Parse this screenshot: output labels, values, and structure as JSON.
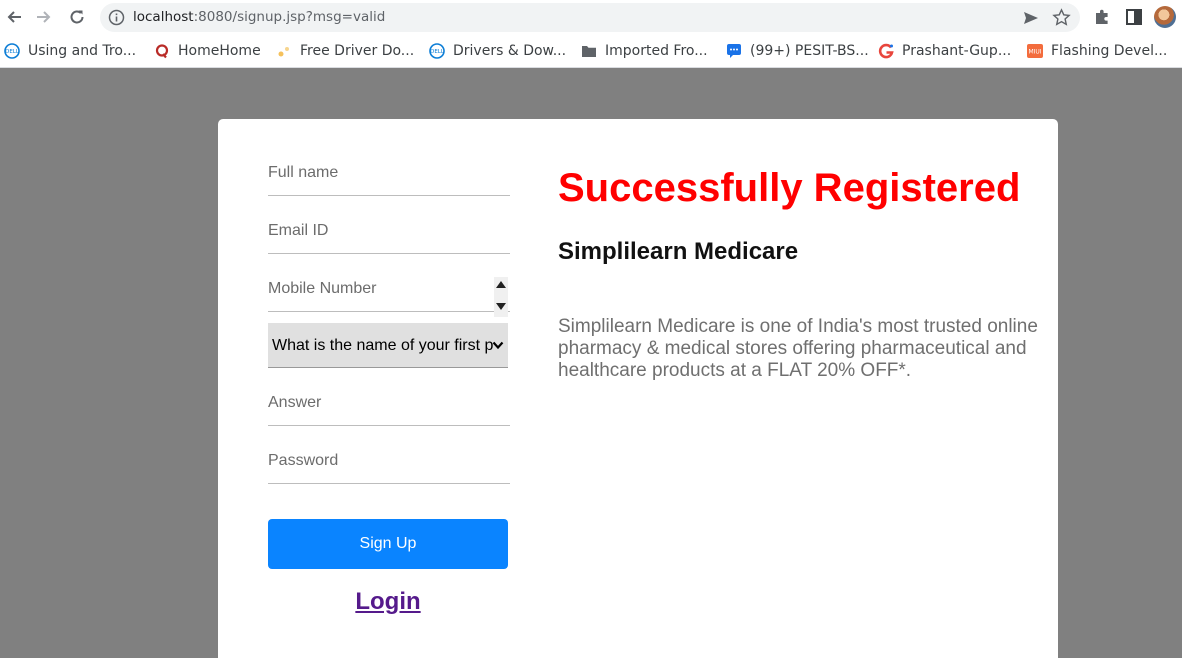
{
  "browser": {
    "url_host": "localhost",
    "url_rest": ":8080/signup.jsp?msg=valid",
    "bookmarks": [
      {
        "label": "Using and Tro...",
        "icon": "dell-icon",
        "color": "#0b7dd6"
      },
      {
        "label": "HomeHome",
        "icon": "quora-icon",
        "color": "#b92b27"
      },
      {
        "label": "Free Driver Do...",
        "icon": "driver-icon",
        "color": "#f5a623"
      },
      {
        "label": "Drivers & Dow...",
        "icon": "dell-icon",
        "color": "#0b7dd6"
      },
      {
        "label": "Imported Fro...",
        "icon": "folder-icon",
        "color": "#5f6368"
      },
      {
        "label": "(99+) PESIT-BS...",
        "icon": "chat-icon",
        "color": "#1a73e8"
      },
      {
        "label": "Prashant-Gup...",
        "icon": "g-icon",
        "color": "#e8453c"
      },
      {
        "label": "Flashing Devel...",
        "icon": "miui-icon",
        "color": "#f36c3d"
      }
    ]
  },
  "form": {
    "fullname_placeholder": "Full name",
    "email_placeholder": "Email ID",
    "mobile_placeholder": "Mobile Number",
    "security_question": "What is the name of your first pet?",
    "answer_placeholder": "Answer",
    "password_placeholder": "Password",
    "signup_label": "Sign Up",
    "login_label": "Login"
  },
  "info": {
    "status": "Successfully Registered",
    "brand": "Simplilearn Medicare",
    "description": "Simplilearn Medicare is one of India's most trusted online pharmacy & medical stores offering pharmaceutical and healthcare products at a FLAT 20% OFF*."
  },
  "colors": {
    "status": "#ff0000",
    "button": "#0a84ff",
    "link": "#551a8b",
    "page_bg": "#808080"
  }
}
